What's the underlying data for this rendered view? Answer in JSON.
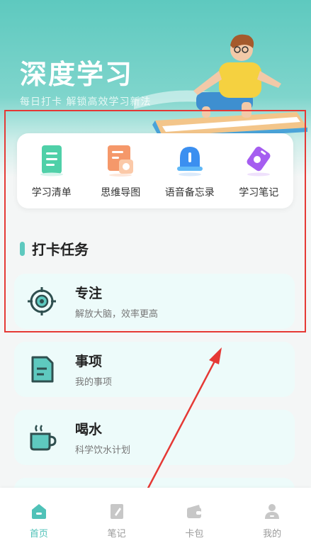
{
  "colors": {
    "accent": "#5ec9bf",
    "annotation": "#e53935",
    "tab_active": "#4fc2b8",
    "tab_inactive": "#c7c7c7"
  },
  "hero": {
    "title": "深度学习",
    "subtitle": "每日打卡  解锁高效学习新法"
  },
  "features": [
    {
      "label": "学习清单",
      "icon": "checklist-icon"
    },
    {
      "label": "思维导图",
      "icon": "mindmap-icon"
    },
    {
      "label": "语音备忘录",
      "icon": "bell-icon"
    },
    {
      "label": "学习笔记",
      "icon": "tag-icon"
    }
  ],
  "section": {
    "title": "打卡任务"
  },
  "tasks": [
    {
      "title": "专注",
      "subtitle": "解放大脑，效率更高",
      "icon": "target-icon"
    },
    {
      "title": "事项",
      "subtitle": "我的事项",
      "icon": "document-icon"
    },
    {
      "title": "喝水",
      "subtitle": "科学饮水计划",
      "icon": "cup-icon"
    }
  ],
  "tabbar": {
    "active_index": 0,
    "items": [
      {
        "label": "首页",
        "icon": "home-icon"
      },
      {
        "label": "笔记",
        "icon": "note-icon"
      },
      {
        "label": "卡包",
        "icon": "wallet-icon"
      },
      {
        "label": "我的",
        "icon": "user-icon"
      }
    ]
  }
}
